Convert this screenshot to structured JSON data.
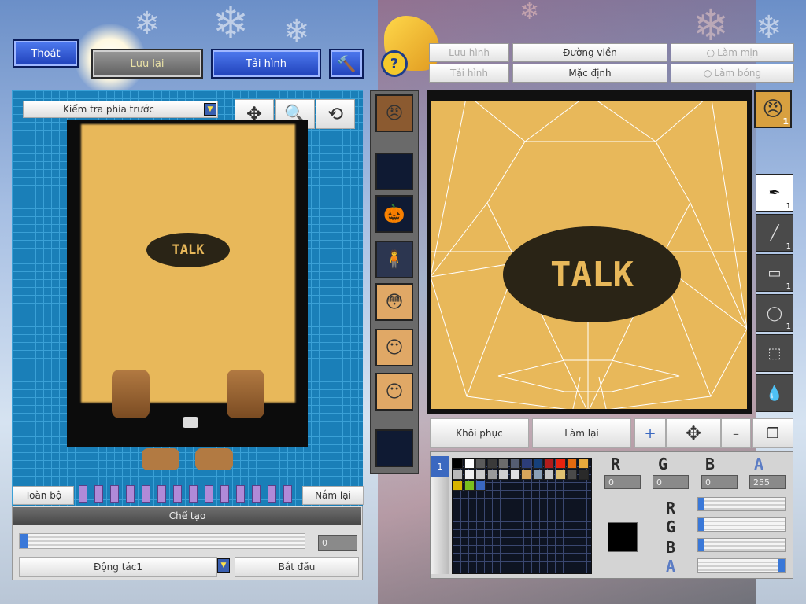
{
  "top_buttons": {
    "exit": "Thoát",
    "save": "Lưu lại",
    "reload": "Tải hình"
  },
  "right_tabs": {
    "save_image": "Lưu hình",
    "border": "Đường viền",
    "smooth": "Làm mịn",
    "load_image": "Tải hình",
    "default": "Mặc định",
    "shade": "Làm bóng"
  },
  "preview": {
    "view_select": "Kiểm tra phía trước",
    "tile_text": "TALK"
  },
  "frame_strip": {
    "all_label": "Toàn bộ",
    "grab_label": "Nắm lại"
  },
  "creation": {
    "title": "Chế tạo",
    "progress_value": "0",
    "action_select": "Động tác1",
    "start_button": "Bắt đầu"
  },
  "editor": {
    "restore_button": "Khôi phục",
    "redo_button": "Làm lại",
    "avatar_badge": "1"
  },
  "tools": [
    {
      "name": "pen-tool",
      "glyph": "✒",
      "count": "1"
    },
    {
      "name": "line-tool",
      "glyph": "╱",
      "count": "1"
    },
    {
      "name": "rect-tool",
      "glyph": "▭",
      "count": "1"
    },
    {
      "name": "ellipse-tool",
      "glyph": "◯",
      "count": "1"
    },
    {
      "name": "select-tool",
      "glyph": "⬚",
      "count": ""
    },
    {
      "name": "eyedropper-tool",
      "glyph": "💧",
      "count": ""
    }
  ],
  "color": {
    "labels": {
      "r": "R",
      "g": "G",
      "b": "B",
      "a": "A"
    },
    "values": {
      "r": "0",
      "g": "0",
      "b": "0",
      "a": "255"
    },
    "current": "#000000"
  },
  "palette": [
    "#000000",
    "#ffffff",
    "#5a5a5a",
    "#3a3a3a",
    "#6c6c6c",
    "#555e72",
    "#2c3d7a",
    "#16407a",
    "#b01c1c",
    "#e8230f",
    "#e36a0f",
    "#e6a83c",
    "#b9b9b9",
    "#f0f0f0",
    "#cbcbcb",
    "#9a9a9a",
    "#d0d0d0",
    "#e0e0e0",
    "#d6a45b",
    "#8aa0b8",
    "#c6c6c6",
    "#e0c070",
    "#4a4a4a",
    "#2a2a2a",
    "#d8b400",
    "#7ac01e",
    "#3a68c0"
  ],
  "accent": {
    "blue_panel": "#1a7fb8",
    "tile": "#e8b85a",
    "dark": "#0e1422"
  }
}
